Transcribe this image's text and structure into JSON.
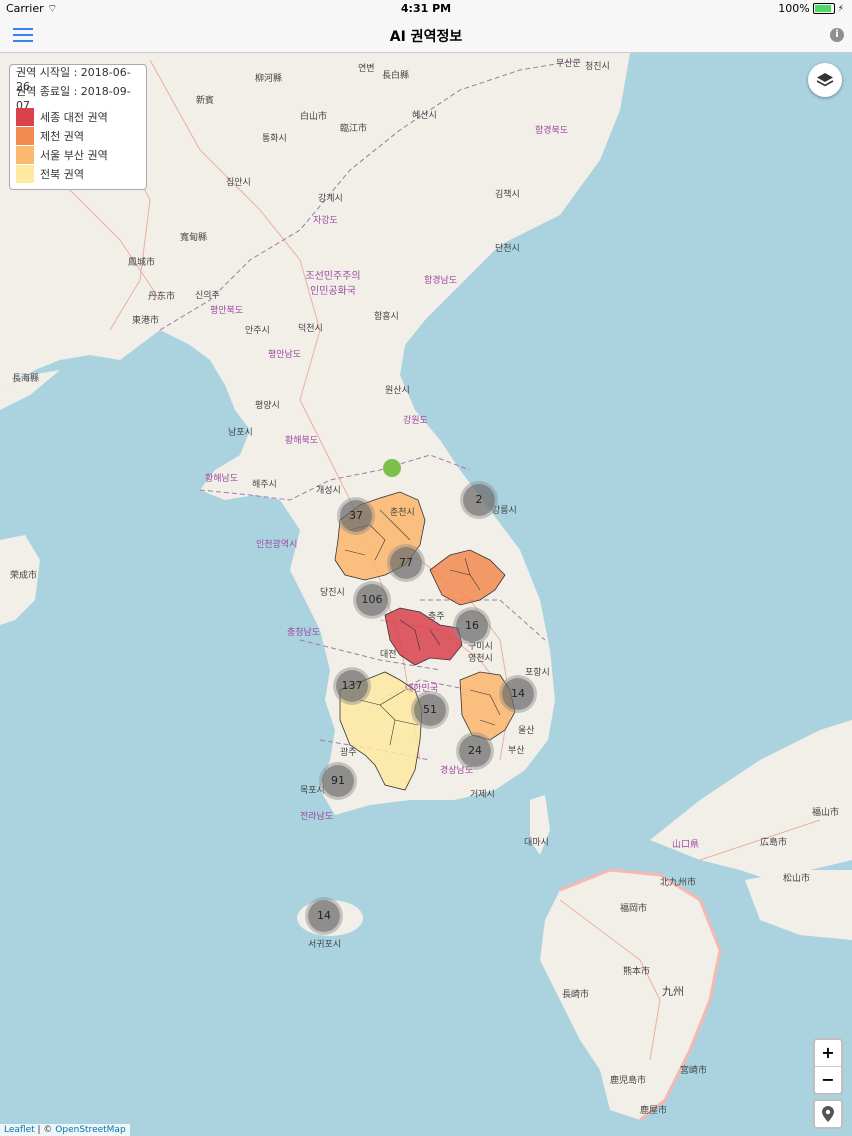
{
  "status": {
    "carrier": "Carrier",
    "time": "4:31 PM",
    "battery": "100%"
  },
  "navbar": {
    "title": "AI 권역정보"
  },
  "legend": {
    "start": "권역 시작일 : 2018-06-26",
    "end": "권역 종료일 : 2018-09-07",
    "items": [
      {
        "label": "세종 대전 권역",
        "color": "#d9414d"
      },
      {
        "label": "제천 권역",
        "color": "#f38a50"
      },
      {
        "label": "서울 부산 권역",
        "color": "#fbb972"
      },
      {
        "label": "전북 권역",
        "color": "#fde9a0"
      }
    ]
  },
  "clusters": [
    "37",
    "2",
    "77",
    "106",
    "16",
    "137",
    "14",
    "51",
    "24",
    "91",
    "14"
  ],
  "labels": {
    "l1": "연변",
    "l2": "柳河縣",
    "l3": "통화시",
    "l4": "白山市",
    "l5": "臨江市",
    "l6": "집안시",
    "l7": "강계시",
    "l8": "자강도",
    "l9": "조선민주주의인민공화국",
    "l10": "함흥시",
    "l11": "평안북도",
    "l12": "평안남도",
    "l13": "평양시",
    "l14": "남포시",
    "l15": "황해북도",
    "l16": "황해남도",
    "l17": "원산시",
    "l18": "강원도",
    "l19": "해주시",
    "l20": "개성시",
    "l21": "춘천시",
    "l22": "강릉시",
    "l23": "인천광역시",
    "l24": "당진시",
    "l25": "충청남도",
    "l26": "대전",
    "l27": "대한민국",
    "l28": "광주",
    "l29": "부산",
    "l30": "울산",
    "l31": "포항시",
    "l32": "구미시",
    "l33": "전라남도",
    "l34": "목포시",
    "l35": "서귀포시",
    "l36": "대마시",
    "l37": "福岡市",
    "l38": "北九州市",
    "l39": "長崎市",
    "l40": "熊本市",
    "l41": "九州",
    "l42": "鹿児島市",
    "l43": "宮崎市",
    "l44": "松山市",
    "l45": "広島市",
    "l46": "山口県",
    "l47": "福山市",
    "l48": "丹东市",
    "l49": "東港市",
    "l50": "長海縣",
    "l51": "荣成市",
    "l52": "함경북도",
    "l53": "함경남도",
    "l54": "단천시",
    "l55": "영천시",
    "l56": "거제시",
    "l57": "경상남도",
    "l58": "충주",
    "l59": "안주시",
    "l60": "덕천시",
    "l61": "신의주",
    "l62": "新賓",
    "l63": "寬甸縣",
    "l64": "鳳城市",
    "l65": "長白縣",
    "l66": "혜산시",
    "l67": "김책시",
    "l68": "청진시",
    "l69": "무산군",
    "l70": "鹿屋市"
  },
  "attribution": {
    "leaflet": "Leaflet",
    "sep": " | © ",
    "osm": "OpenStreetMap"
  },
  "zoom": {
    "in": "+",
    "out": "−"
  }
}
